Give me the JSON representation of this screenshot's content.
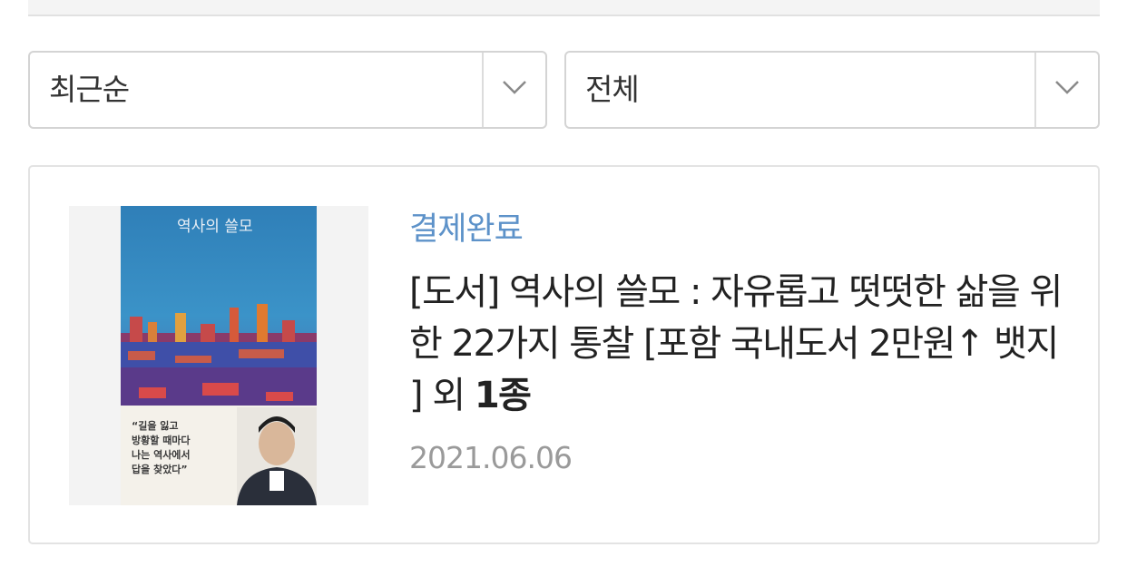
{
  "filters": {
    "sort": {
      "value": "최근순",
      "icon": "chevron-down-icon"
    },
    "category": {
      "value": "전체",
      "icon": "chevron-down-icon"
    }
  },
  "order": {
    "status": "결제완료",
    "status_color": "#5d92c9",
    "title": "[도서] 역사의 쓸모 : 자유롭고 떳떳한 삶을 위한 22가지 통찰 [포함 국내도서 2만원↑ 뱃지 ] 외",
    "count_text": "1종",
    "date": "2021.06.06",
    "cover": {
      "title": "역사의 쓸모",
      "quote": "“길을 잃고\n방황할 때마다\n나는 역사에서\n답을 찾았다”"
    }
  }
}
